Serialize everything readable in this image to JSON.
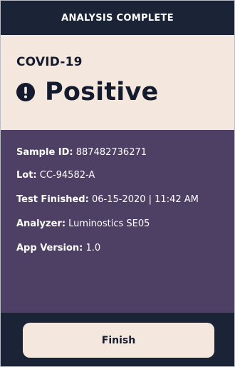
{
  "header": {
    "title": "ANALYSIS COMPLETE"
  },
  "result": {
    "test_name": "COVID-19",
    "status": "Positive",
    "icon": "exclamation-circle-icon"
  },
  "details": [
    {
      "label": "Sample ID:",
      "value": "887482736271"
    },
    {
      "label": "Lot:",
      "value": "CC-94582-A"
    },
    {
      "label": "Test Finished:",
      "value": "06-15-2020 | 11:42 AM"
    },
    {
      "label": "Analyzer:",
      "value": "Luminostics SE05"
    },
    {
      "label": "App Version:",
      "value": "1.0"
    }
  ],
  "footer": {
    "finish_label": "Finish"
  },
  "colors": {
    "navy": "#1b2437",
    "cream": "#f3e7de",
    "purple": "#4e4065",
    "text_dark": "#151b2e"
  }
}
